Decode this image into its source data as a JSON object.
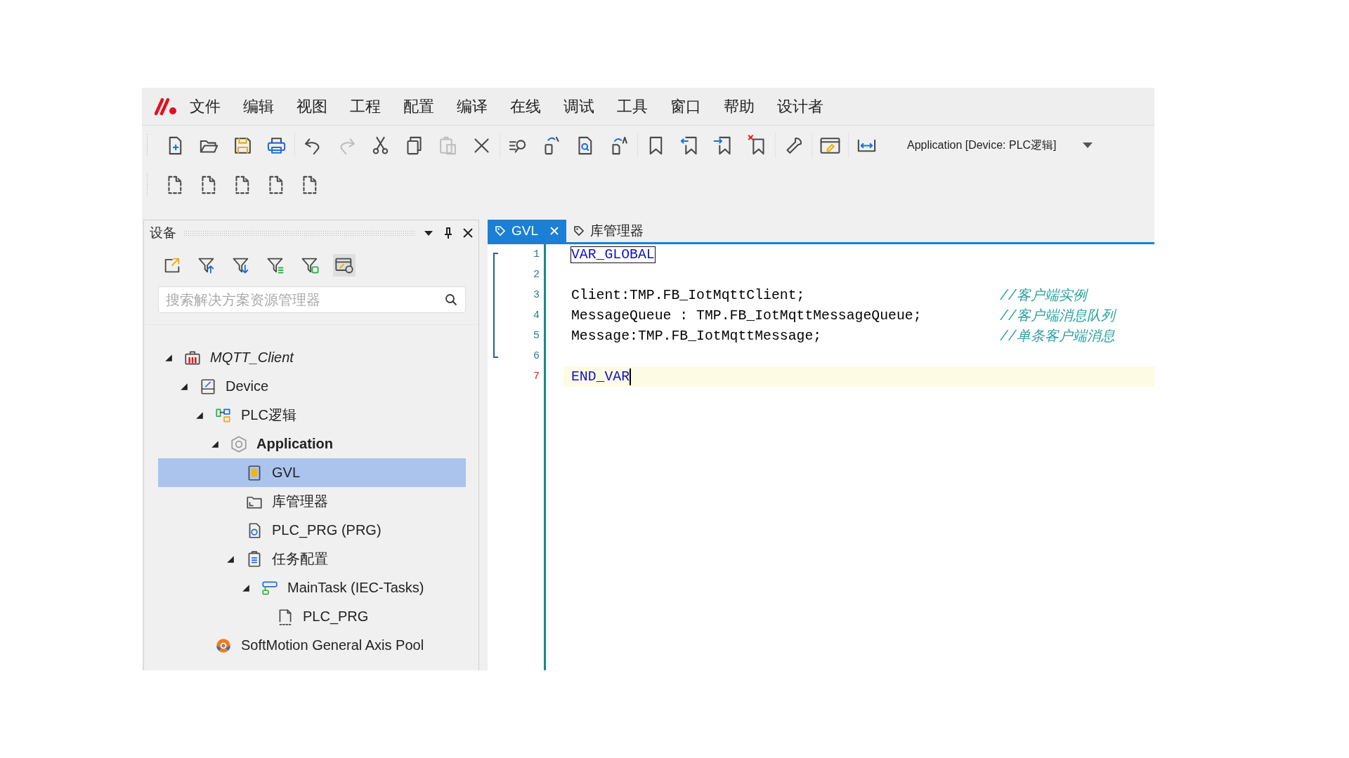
{
  "menu": {
    "items": [
      "文件",
      "编辑",
      "视图",
      "工程",
      "配置",
      "编译",
      "在线",
      "调试",
      "工具",
      "窗口",
      "帮助",
      "设计者"
    ]
  },
  "toolbar": {
    "rows": [
      {
        "groups": [
          [
            {
              "kind": "new-file",
              "disabled": false
            },
            {
              "kind": "open-folder",
              "disabled": false
            },
            {
              "kind": "save",
              "disabled": false
            },
            {
              "kind": "print",
              "disabled": false
            }
          ],
          [
            {
              "kind": "undo",
              "disabled": false
            },
            {
              "kind": "redo",
              "disabled": true
            },
            {
              "kind": "cut",
              "disabled": false
            },
            {
              "kind": "copy",
              "disabled": false
            },
            {
              "kind": "paste",
              "disabled": true
            },
            {
              "kind": "delete",
              "disabled": false
            }
          ],
          [
            {
              "kind": "find",
              "disabled": false
            },
            {
              "kind": "replace-device",
              "disabled": false
            },
            {
              "kind": "search-document",
              "disabled": false
            },
            {
              "kind": "replace-page",
              "disabled": false
            }
          ],
          [
            {
              "kind": "bookmark",
              "disabled": false
            },
            {
              "kind": "bookmark-previous",
              "disabled": false
            },
            {
              "kind": "bookmark-next",
              "disabled": false
            },
            {
              "kind": "bookmark-clear",
              "disabled": false
            }
          ],
          [
            {
              "kind": "wrench",
              "disabled": false
            }
          ],
          [
            {
              "kind": "window-edit",
              "disabled": false
            }
          ],
          [
            {
              "kind": "width-arrows",
              "disabled": false
            }
          ]
        ]
      },
      {
        "groups": [
          [
            {
              "kind": "dashed-page",
              "disabled": false
            },
            {
              "kind": "dashed-page",
              "disabled": false
            },
            {
              "kind": "dashed-page",
              "disabled": false
            },
            {
              "kind": "dashed-page",
              "disabled": false
            },
            {
              "kind": "dashed-page",
              "disabled": false
            }
          ]
        ]
      }
    ],
    "target_selector": {
      "value": "Application [Device: PLC逻辑]"
    }
  },
  "devices_panel": {
    "title": "设备",
    "tools": [
      {
        "kind": "export",
        "on": false
      },
      {
        "kind": "filter-up",
        "on": false
      },
      {
        "kind": "filter-down",
        "on": false
      },
      {
        "kind": "filter-list",
        "on": false
      },
      {
        "kind": "filter-add",
        "on": false
      },
      {
        "kind": "window-settings",
        "on": true
      }
    ],
    "search": {
      "placeholder": "搜索解决方案资源管理器"
    },
    "tree": [
      {
        "label": "MQTT_Client",
        "kind": "project",
        "selected": false,
        "expanded": true,
        "active": false,
        "children": [
          {
            "label": "Device",
            "kind": "device",
            "selected": false,
            "expanded": true,
            "active": false,
            "children": [
              {
                "label": "PLC逻辑",
                "kind": "plc-logic",
                "selected": false,
                "expanded": true,
                "active": false,
                "children": [
                  {
                    "label": "Application",
                    "kind": "application",
                    "selected": false,
                    "expanded": true,
                    "active": true,
                    "children": [
                      {
                        "label": "GVL",
                        "kind": "gvl",
                        "selected": true,
                        "expanded": false,
                        "active": false
                      },
                      {
                        "label": "库管理器",
                        "kind": "library",
                        "selected": false,
                        "expanded": false,
                        "active": false
                      },
                      {
                        "label": "PLC_PRG (PRG)",
                        "kind": "program",
                        "selected": false,
                        "expanded": false,
                        "active": false
                      },
                      {
                        "label": "任务配置",
                        "kind": "task-config",
                        "selected": false,
                        "expanded": true,
                        "active": false,
                        "children": [
                          {
                            "label": "MainTask (IEC-Tasks)",
                            "kind": "task",
                            "selected": false,
                            "expanded": true,
                            "active": false,
                            "children": [
                              {
                                "label": "PLC_PRG",
                                "kind": "program-call",
                                "selected": false,
                                "expanded": false,
                                "active": false
                              }
                            ]
                          }
                        ]
                      }
                    ]
                  }
                ]
              },
              {
                "label": "SoftMotion General Axis Pool",
                "kind": "axis-pool",
                "selected": false,
                "expanded": false,
                "active": false
              }
            ]
          }
        ]
      }
    ]
  },
  "editor": {
    "tabs": [
      {
        "label": "GVL",
        "selected": true
      },
      {
        "label": "库管理器",
        "selected": false
      }
    ],
    "lines": [
      {
        "number": "1",
        "kind": "keyword",
        "code": "VAR_GLOBAL",
        "boxed": true,
        "current": false
      },
      {
        "number": "2",
        "current": false
      },
      {
        "number": "3",
        "kind": "plain",
        "code": "Client:TMP.FB_IotMqttClient;",
        "comment": "//客户端实例",
        "boxed": false,
        "current": false
      },
      {
        "number": "4",
        "kind": "plain",
        "code": "MessageQueue : TMP.FB_IotMqttMessageQueue;",
        "comment": "//客户端消息队列",
        "boxed": false,
        "current": false
      },
      {
        "number": "5",
        "kind": "plain",
        "code": "Message:TMP.FB_IotMqttMessage;",
        "comment": "//单条客户端消息",
        "boxed": false,
        "current": false
      },
      {
        "number": "6",
        "current": false
      },
      {
        "number": "7",
        "kind": "keyword",
        "code": "END_VAR",
        "boxed": false,
        "current": true
      }
    ]
  }
}
